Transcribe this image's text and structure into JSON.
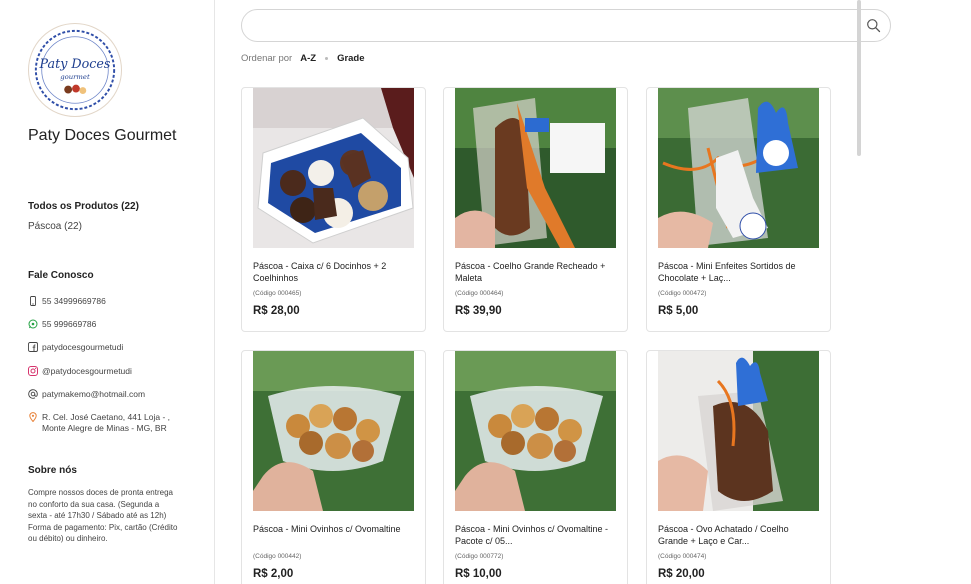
{
  "store": {
    "name": "Paty Doces Gourmet",
    "logo_text": "Paty Doces",
    "logo_subtext": "gourmet"
  },
  "categories": {
    "title": "Todos os Produtos (22)",
    "items": [
      "Páscoa (22)"
    ]
  },
  "contact": {
    "title": "Fale Conosco",
    "phone": "55 34999669786",
    "whatsapp": "55 999669786",
    "facebook": "patydocesgourmetudi",
    "instagram": "@patydocesgourmetudi",
    "email": "patymakemo@hotmail.com",
    "address_line1": "R. Cel. José Caetano, 441 Loja - ,",
    "address_line2": "Monte Alegre de Minas - MG, BR"
  },
  "about": {
    "title": "Sobre nós",
    "text": "Compre nossos doces de pronta entrega no conforto da sua casa. (Segunda a sexta - até 17h30 / Sábado até as 12h) Forma de pagamento: Pix, cartão (Crédito ou débito) ou dinheiro."
  },
  "search": {
    "placeholder": ""
  },
  "sort": {
    "label": "Ordenar por",
    "value": "A-Z",
    "view": "Grade"
  },
  "products": [
    {
      "name": "Páscoa - Caixa c/ 6 Docinhos + 2 Coelhinhos",
      "code": "(Código 000465)",
      "price": "R$ 28,00"
    },
    {
      "name": "Páscoa - Coelho Grande Recheado + Maleta",
      "code": "(Código 000464)",
      "price": "R$ 39,90"
    },
    {
      "name": "Páscoa - Mini Enfeites Sortidos de Chocolate + Laç...",
      "code": "(Código 000472)",
      "price": "R$ 5,00"
    },
    {
      "name": "Páscoa - Mini Ovinhos c/ Ovomaltine",
      "code": "(Código 000442)",
      "price": "R$ 2,00"
    },
    {
      "name": "Páscoa - Mini Ovinhos c/ Ovomaltine - Pacote c/ 05...",
      "code": "(Código 000772)",
      "price": "R$ 10,00"
    },
    {
      "name": "Páscoa - Ovo Achatado / Coelho Grande + Laço e Car...",
      "code": "(Código 000474)",
      "price": "R$ 20,00"
    }
  ],
  "colors": {
    "border": "#e3e3e3",
    "text": "#222222",
    "muted": "#777777"
  }
}
